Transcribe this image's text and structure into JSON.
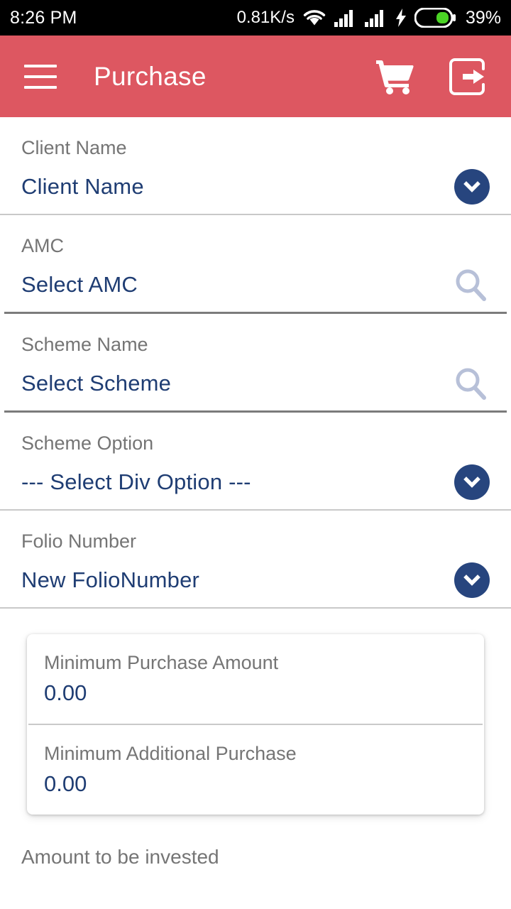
{
  "status_bar": {
    "time": "8:26 PM",
    "network_speed": "0.81K/s",
    "wifi_icon": "wifi-icon",
    "signal_one_icon": "signal-bars-icon",
    "signal_two_icon": "signal-bars-icon",
    "charging_icon": "charging-bolt-icon",
    "battery_icon": "battery-icon",
    "battery_percent": "39%",
    "background": "#000000",
    "foreground": "#ffffff"
  },
  "app_bar": {
    "menu_icon": "hamburger-menu-icon",
    "title": "Purchase",
    "cart_icon": "shopping-cart-icon",
    "logout_icon": "logout-icon",
    "background": "#dd5761",
    "foreground": "#ffffff"
  },
  "theme": {
    "value_color": "#1f3d73",
    "label_color": "#757575",
    "accent_circle": "#27457e",
    "search_icon_color": "#b7c0d8"
  },
  "form": {
    "fields": [
      {
        "label": "Client Name",
        "value": "Client Name",
        "trailing": "chevron-down-icon",
        "underline": "light"
      },
      {
        "label": "AMC",
        "value": "Select AMC",
        "trailing": "search-icon",
        "underline": "dark"
      },
      {
        "label": "Scheme Name",
        "value": "Select Scheme",
        "trailing": "search-icon",
        "underline": "dark"
      },
      {
        "label": "Scheme Option",
        "value": "--- Select Div Option ---",
        "trailing": "chevron-down-icon",
        "underline": "light"
      },
      {
        "label": "Folio Number",
        "value": "New FolioNumber",
        "trailing": "chevron-down-icon",
        "underline": "light"
      }
    ]
  },
  "minimum_card": {
    "rows": [
      {
        "label": "Minimum Purchase Amount",
        "value": "0.00"
      },
      {
        "label": "Minimum Additional Purchase",
        "value": "0.00"
      }
    ]
  },
  "amount_section": {
    "label": "Amount to be invested"
  }
}
